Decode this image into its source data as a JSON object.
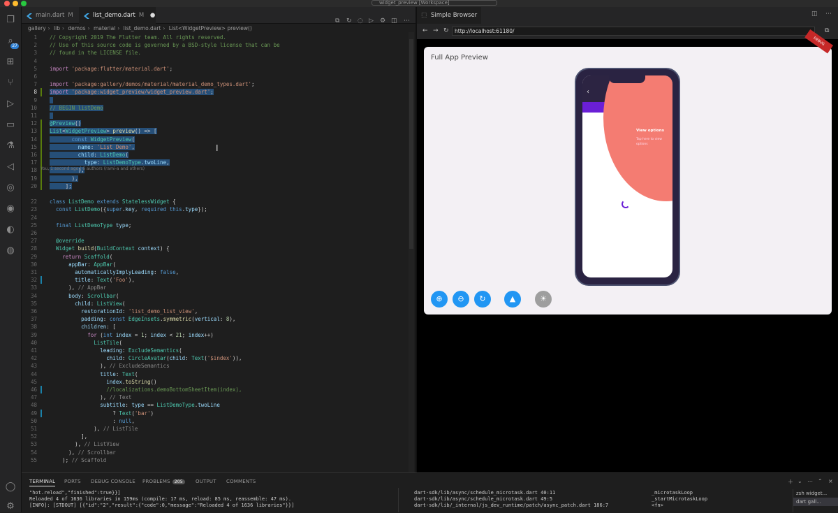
{
  "window": {
    "title": "widget_preview [Workspace]"
  },
  "activity_bar": [
    {
      "icon": "files-icon"
    },
    {
      "icon": "source-control-icon",
      "badge": "27"
    },
    {
      "icon": "extensions-icon"
    },
    {
      "icon": "git-graph-icon"
    },
    {
      "icon": "run-debug-icon"
    },
    {
      "icon": "remote-explorer-icon"
    },
    {
      "icon": "testing-icon"
    },
    {
      "icon": "flutter-icon"
    },
    {
      "icon": "database-icon"
    },
    {
      "icon": "github-icon"
    },
    {
      "icon": "timeline-icon"
    },
    {
      "icon": "globe-icon"
    },
    {
      "icon": "account-icon"
    },
    {
      "icon": "settings-icon"
    }
  ],
  "editor_tabs": [
    {
      "name": "main.dart",
      "status": "M"
    },
    {
      "name": "list_demo.dart",
      "status": "M"
    }
  ],
  "breadcrumbs": [
    "gallery",
    "lib",
    "demos",
    "material",
    "list_demo.dart",
    "List<WidgetPreview> preview()"
  ],
  "code_lines": [
    {
      "n": "1",
      "html": "<span class='c'>// Copyright 2019 The Flutter team. All rights reserved.</span>"
    },
    {
      "n": "2",
      "html": "<span class='c'>// Use of this source code is governed by a BSD-style license that can be</span>"
    },
    {
      "n": "3",
      "html": "<span class='c'>// found in the LICENSE file.</span>"
    },
    {
      "n": "4",
      "html": ""
    },
    {
      "n": "5",
      "html": "<span class='kw'>import</span> <span class='s'>'package:flutter/material.dart'</span><span class='p'>;</span>"
    },
    {
      "n": "6",
      "html": ""
    },
    {
      "n": "7",
      "html": "<span class='kw'>import</span> <span class='s'>'package:gallery/demos/material/material_demo_types.dart'</span><span class='p'>;</span>"
    },
    {
      "n": "8",
      "html": "<span class='sel'><span class='kw'>import</span> <span class='s'>'package:widget_preview/widget_preview.dart'</span><span class='p'>;</span></span>",
      "cur": true
    },
    {
      "n": "9",
      "html": "<span class='sel'> </span>"
    },
    {
      "n": "10",
      "html": "<span class='sel'><span class='c'>// BEGIN listDemo</span></span>"
    },
    {
      "n": "11",
      "html": "<span class='sel'> </span>"
    },
    {
      "n": "12",
      "html": "<span class='sel'><span class='t'>@Preview</span><span class='p'>()</span></span>"
    },
    {
      "n": "13",
      "html": "<span class='sel'><span class='t'>List</span><span class='p'>&lt;</span><span class='t'>WidgetPreview</span><span class='p'>&gt;</span> <span class='f'>preview</span><span class='p'>() =&gt; [</span></span>"
    },
    {
      "n": "14",
      "html": "<span class='sel'>       <span class='k'>const</span> <span class='t'>WidgetPreview</span><span class='p'>(</span></span>"
    },
    {
      "n": "15",
      "html": "<span class='sel'>         <span class='v'>name</span><span class='p'>:</span> <span class='s'>'List Demo'</span><span class='p'>,</span></span>"
    },
    {
      "n": "16",
      "html": "<span class='sel'>         <span class='v'>child</span><span class='p'>:</span> <span class='t'>ListDemo</span><span class='p'>(</span></span>"
    },
    {
      "n": "17",
      "html": "<span class='sel'>           <span class='v'>type</span><span class='p'>:</span> <span class='t'>ListDemoType</span><span class='p'>.</span><span class='v'>twoLine</span><span class='p'>,</span></span>"
    },
    {
      "n": "18",
      "html": "<span class='sel'>         <span class='p'>),</span></span>"
    },
    {
      "n": "19",
      "html": "<span class='sel'>       <span class='p'>),</span></span>"
    },
    {
      "n": "20",
      "html": "<span class='sel'>     <span class='p'>];</span></span>"
    },
    {
      "n": "",
      "html": ""
    },
    {
      "n": "22",
      "html": "<span class='k'>class</span> <span class='t'>ListDemo</span> <span class='k'>extends</span> <span class='t'>StatelessWidget</span> <span class='p'>{</span>"
    },
    {
      "n": "23",
      "html": "  <span class='k'>const</span> <span class='t'>ListDemo</span><span class='p'>({</span><span class='k'>super</span><span class='p'>.</span><span class='v'>key</span><span class='p'>,</span> <span class='k'>required</span> <span class='k'>this</span><span class='p'>.</span><span class='v'>type</span><span class='p'>});</span>"
    },
    {
      "n": "24",
      "html": ""
    },
    {
      "n": "25",
      "html": "  <span class='k'>final</span> <span class='t'>ListDemoType</span> <span class='v'>type</span><span class='p'>;</span>"
    },
    {
      "n": "26",
      "html": ""
    },
    {
      "n": "27",
      "html": "  <span class='t'>@override</span>"
    },
    {
      "n": "28",
      "html": "  <span class='t'>Widget</span> <span class='f'>build</span><span class='p'>(</span><span class='t'>BuildContext</span> <span class='v'>context</span><span class='p'>) {</span>"
    },
    {
      "n": "29",
      "html": "    <span class='kw'>return</span> <span class='t'>Scaffold</span><span class='p'>(</span>"
    },
    {
      "n": "30",
      "html": "      <span class='v'>appBar</span><span class='p'>:</span> <span class='t'>AppBar</span><span class='p'>(</span>"
    },
    {
      "n": "31",
      "html": "        <span class='v'>automaticallyImplyLeading</span><span class='p'>:</span> <span class='k'>false</span><span class='p'>,</span>"
    },
    {
      "n": "32",
      "html": "        <span class='v'>title</span><span class='p'>:</span> <span class='t'>Text</span><span class='p'>(</span><span class='s'>'Foo'</span><span class='p'>),</span>"
    },
    {
      "n": "33",
      "html": "      <span class='p'>),</span> <span class='gr'>// AppBar</span>"
    },
    {
      "n": "34",
      "html": "      <span class='v'>body</span><span class='p'>:</span> <span class='t'>Scrollbar</span><span class='p'>(</span>"
    },
    {
      "n": "35",
      "html": "        <span class='v'>child</span><span class='p'>:</span> <span class='t'>ListView</span><span class='p'>(</span>"
    },
    {
      "n": "36",
      "html": "          <span class='v'>restorationId</span><span class='p'>:</span> <span class='s'>'list_demo_list_view'</span><span class='p'>,</span>"
    },
    {
      "n": "37",
      "html": "          <span class='v'>padding</span><span class='p'>:</span> <span class='k'>const</span> <span class='t'>EdgeInsets</span><span class='p'>.</span><span class='f'>symmetric</span><span class='p'>(</span><span class='v'>vertical</span><span class='p'>:</span> <span class='n'>8</span><span class='p'>),</span>"
    },
    {
      "n": "38",
      "html": "          <span class='v'>children</span><span class='p'>: [</span>"
    },
    {
      "n": "39",
      "html": "            <span class='kw'>for</span> <span class='p'>(</span><span class='k'>int</span> <span class='v'>index</span> <span class='p'>=</span> <span class='n'>1</span><span class='p'>;</span> <span class='v'>index</span> <span class='p'>&lt;</span> <span class='n'>21</span><span class='p'>;</span> <span class='v'>index</span><span class='p'>++)</span>"
    },
    {
      "n": "40",
      "html": "              <span class='t'>ListTile</span><span class='p'>(</span>"
    },
    {
      "n": "41",
      "html": "                <span class='v'>leading</span><span class='p'>:</span> <span class='t'>ExcludeSemantics</span><span class='p'>(</span>"
    },
    {
      "n": "42",
      "html": "                  <span class='v'>child</span><span class='p'>:</span> <span class='t'>CircleAvatar</span><span class='p'>(</span><span class='v'>child</span><span class='p'>:</span> <span class='t'>Text</span><span class='p'>(</span><span class='s'>'$index'</span><span class='p'>)),</span>"
    },
    {
      "n": "43",
      "html": "                <span class='p'>),</span> <span class='gr'>// ExcludeSemantics</span>"
    },
    {
      "n": "44",
      "html": "                <span class='v'>title</span><span class='p'>:</span> <span class='t'>Text</span><span class='p'>(</span>"
    },
    {
      "n": "45",
      "html": "                  <span class='v'>index</span><span class='p'>.</span><span class='f'>toString</span><span class='p'>()</span>"
    },
    {
      "n": "46",
      "html": "                  <span class='c'>//localizations.demoBottomSheetItem(index),</span>"
    },
    {
      "n": "47",
      "html": "                <span class='p'>),</span> <span class='gr'>// Text</span>"
    },
    {
      "n": "48",
      "html": "                <span class='v'>subtitle</span><span class='p'>:</span> <span class='v'>type</span> <span class='p'>==</span> <span class='t'>ListDemoType</span><span class='p'>.</span><span class='v'>twoLine</span>"
    },
    {
      "n": "49",
      "html": "                    <span class='p'>?</span> <span class='t'>Text</span><span class='p'>(</span><span class='s'>'bar'</span><span class='p'>)</span>"
    },
    {
      "n": "50",
      "html": "                    <span class='p'>:</span> <span class='k'>null</span><span class='p'>,</span>"
    },
    {
      "n": "51",
      "html": "              <span class='p'>),</span> <span class='gr'>// ListTile</span>"
    },
    {
      "n": "52",
      "html": "          <span class='p'>],</span>"
    },
    {
      "n": "53",
      "html": "        <span class='p'>),</span> <span class='gr'>// ListView</span>"
    },
    {
      "n": "54",
      "html": "      <span class='p'>),</span> <span class='gr'>// Scrollbar</span>"
    },
    {
      "n": "55",
      "html": "    <span class='p'>);</span> <span class='gr'>// Scaffold</span>"
    }
  ],
  "blame_text": "You, 1 second ago | 6 authors (rami-a and others)",
  "browser": {
    "tab_title": "Simple Browser",
    "url": "http://localhost:61180/",
    "preview_title": "Full App Preview",
    "ribbon": "DEBUG",
    "spotlight_title": "View options",
    "spotlight_body": "Tap here to view options"
  },
  "panel": {
    "tabs": [
      {
        "label": "TERMINAL"
      },
      {
        "label": "PORTS"
      },
      {
        "label": "DEBUG CONSOLE"
      },
      {
        "label": "PROBLEMS",
        "count": "205"
      },
      {
        "label": "OUTPUT"
      },
      {
        "label": "COMMENTS"
      }
    ],
    "terminal_left": "\"hot.reload\",\"finished\":true}}]\nReloaded 4 of 1636 libraries in 159ms (compile: 17 ms, reload: 85 ms, reassemble: 47 ms).\n[INFO]: [STDOUT] [{\"id\":\"2\",\"result\":{\"code\":0,\"message\":\"Reloaded 4 of 1636 libraries\"}}]",
    "terminal_mid": "dart-sdk/lib/async/schedule_microtask.dart 40:11\ndart-sdk/lib/async/schedule_microtask.dart 49:5\ndart-sdk/lib/_internal/js_dev_runtime/patch/async_patch.dart 186:7",
    "terminal_right": "_microtaskLoop\n_startMicrotaskLoop\n<fn>",
    "terminals": [
      "zsh  widget...",
      "dart  gall..."
    ]
  }
}
